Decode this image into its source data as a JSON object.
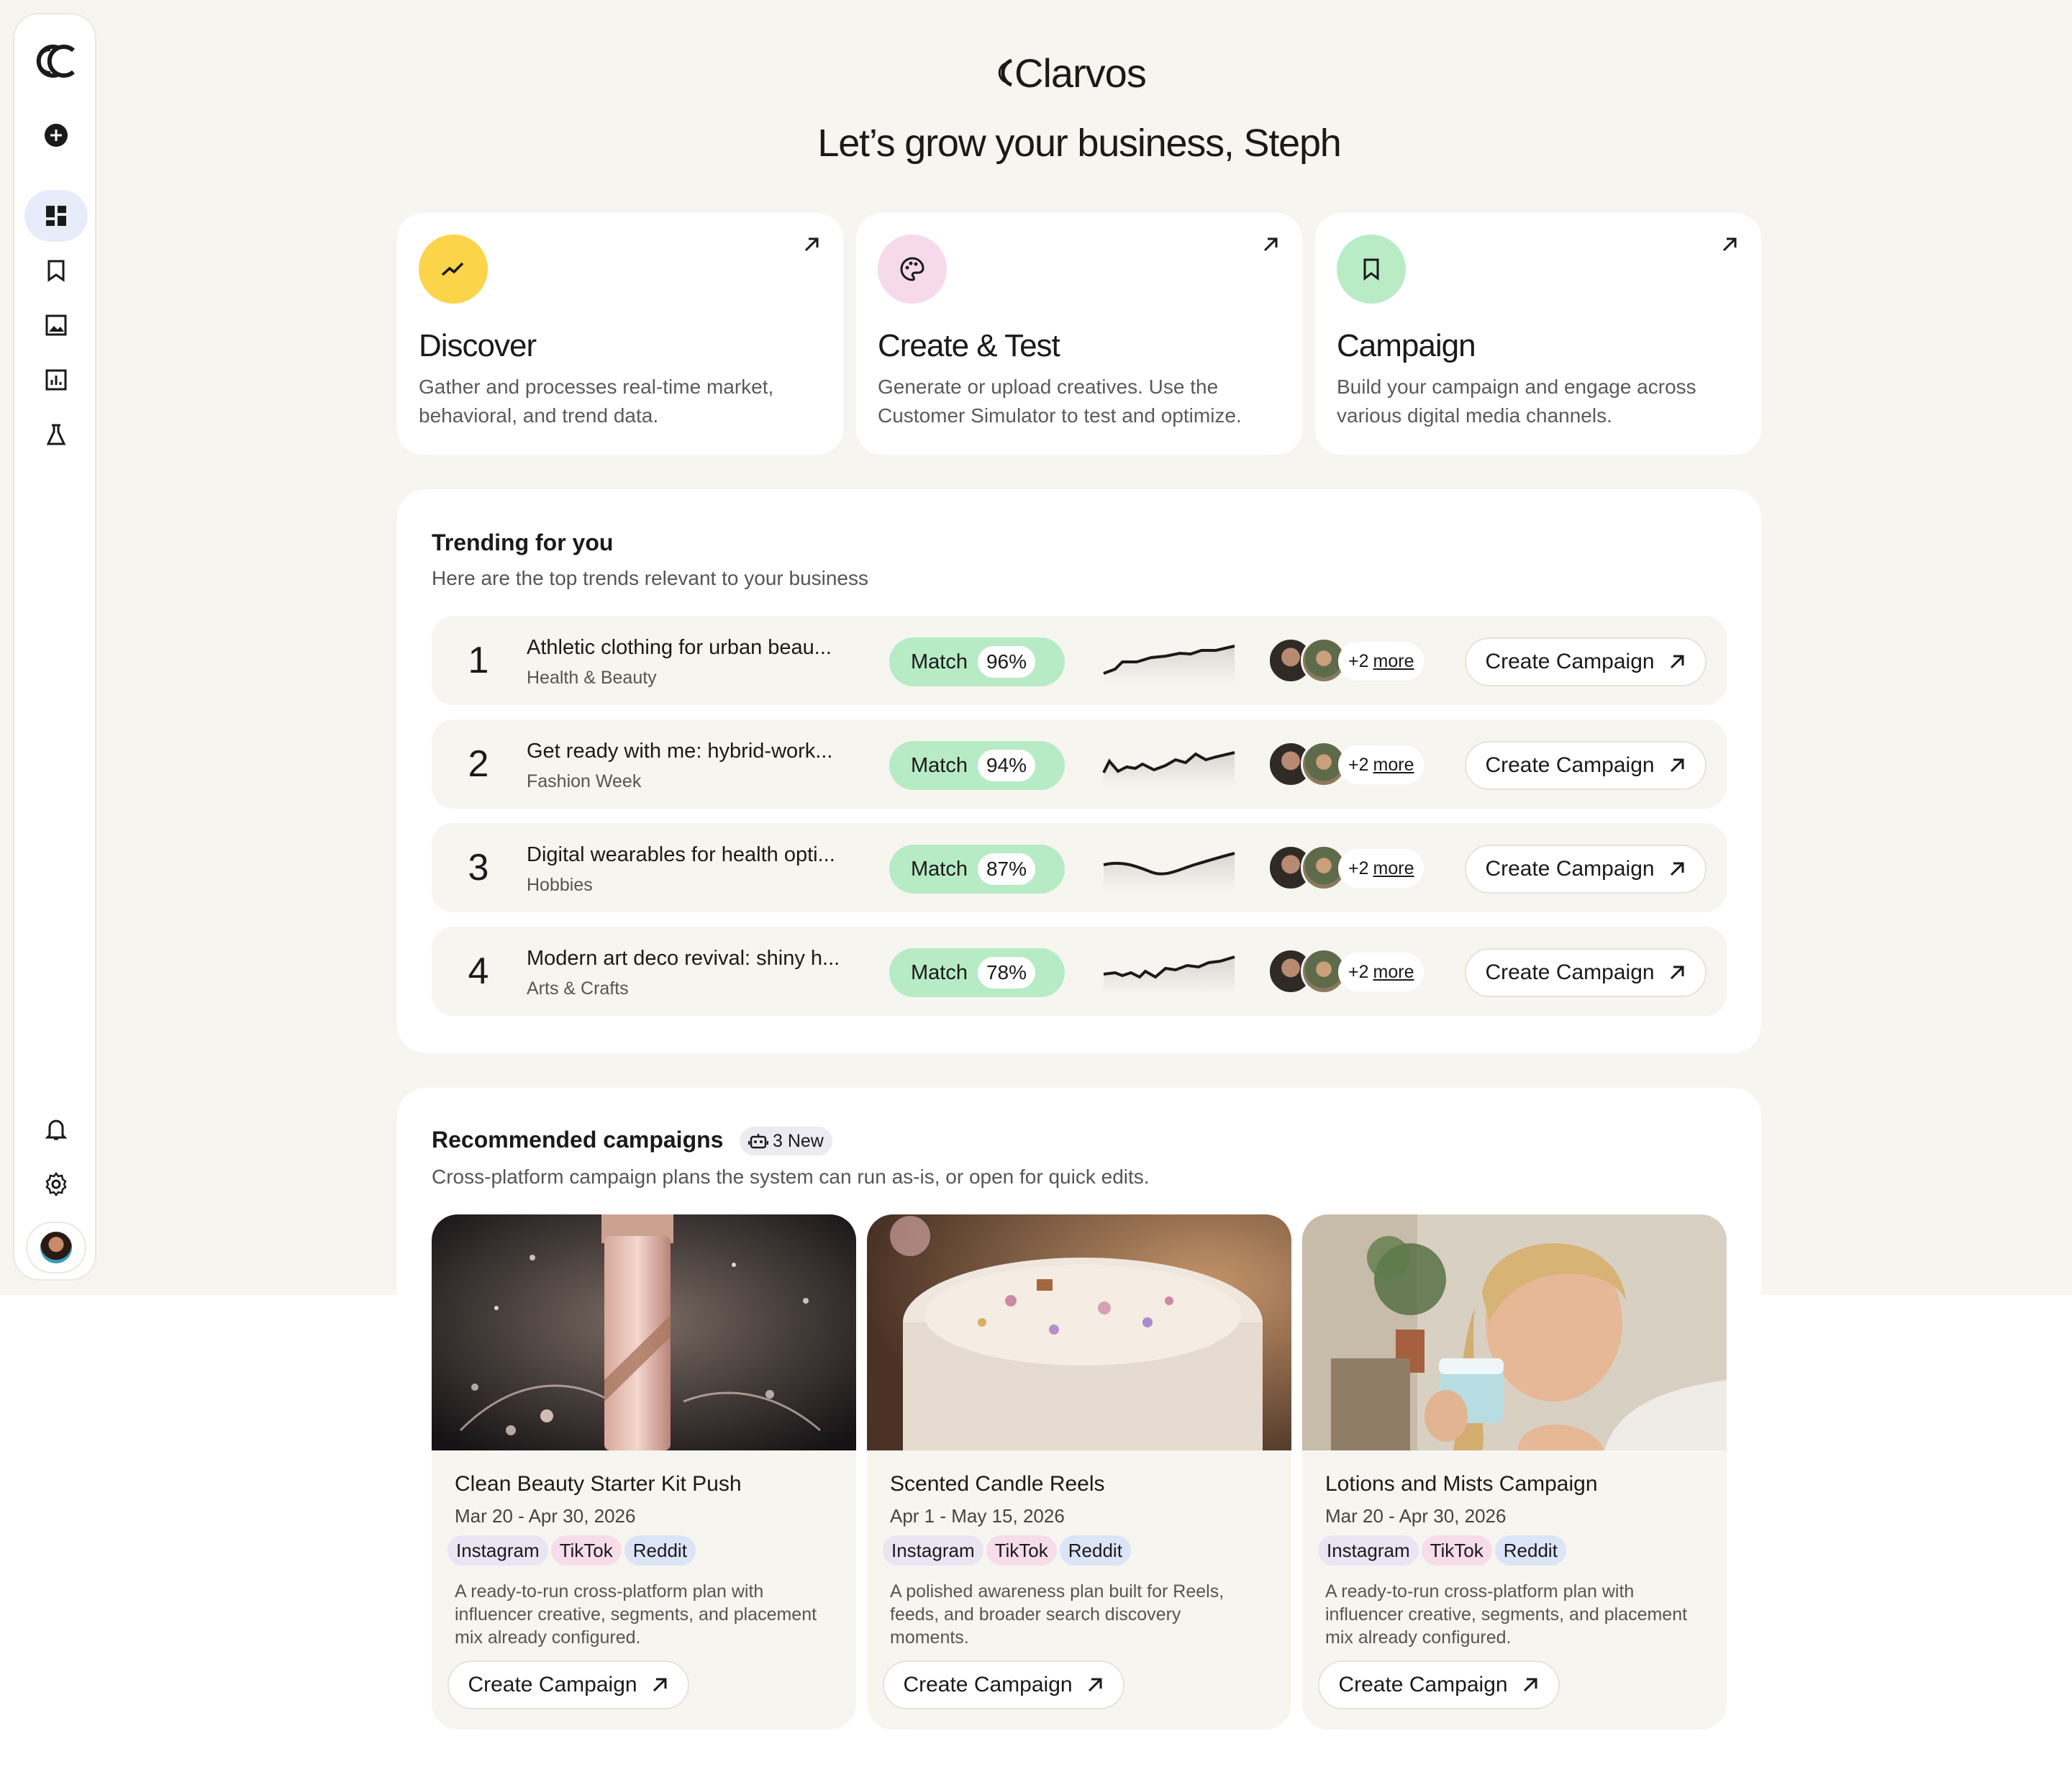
{
  "brand": {
    "name": "Clarvos"
  },
  "greeting": "Let’s grow your business, Steph",
  "cards": [
    {
      "title": "Discover",
      "desc": "Gather and processes real-time market, behavioral, and trend data.",
      "icon": "trend-icon",
      "color": "#fbd44a"
    },
    {
      "title": "Create & Test",
      "desc": "Generate or upload creatives. Use the Customer Simulator to test and optimize.",
      "icon": "palette-icon",
      "color": "#f7d9ec"
    },
    {
      "title": "Campaign",
      "desc": "Build your campaign and engage across various digital media channels.",
      "icon": "bookmark-icon",
      "color": "#b9ecc5"
    }
  ],
  "trending": {
    "title": "Trending for you",
    "subtitle": "Here are the top trends relevant to your business",
    "match_label": "Match",
    "more_prefix": "+2",
    "more_label": "more",
    "cta": "Create Campaign",
    "rows": [
      {
        "rank": "1",
        "title": "Athletic clothing for urban beau...",
        "category": "Health & Beauty",
        "match": "96%"
      },
      {
        "rank": "2",
        "title": "Get ready with me: hybrid-work...",
        "category": "Fashion Week",
        "match": "94%"
      },
      {
        "rank": "3",
        "title": "Digital wearables for health opti...",
        "category": "Hobbies",
        "match": "87%"
      },
      {
        "rank": "4",
        "title": "Modern art deco revival: shiny h...",
        "category": "Arts & Crafts",
        "match": "78%"
      }
    ]
  },
  "recommended": {
    "title": "Recommended campaigns",
    "badge": "3 New",
    "subtitle": "Cross-platform campaign plans the system can run as-is, or open for quick edits.",
    "cta": "Create Campaign",
    "tags": [
      "Instagram",
      "TikTok",
      "Reddit"
    ],
    "items": [
      {
        "title": "Clean Beauty Starter Kit Push",
        "dates": "Mar 20 - Apr 30, 2026",
        "desc": "A ready-to-run cross-platform plan with influencer creative, segments, and placement mix already configured."
      },
      {
        "title": "Scented Candle Reels",
        "dates": "Apr 1 - May 15, 2026",
        "desc": "A polished awareness plan built for Reels, feeds, and broader search discovery moments."
      },
      {
        "title": "Lotions and Mists Campaign",
        "dates": "Mar 20 - Apr 30, 2026",
        "desc": "A ready-to-run cross-platform plan with influencer creative, segments, and placement mix already configured."
      }
    ]
  },
  "sidebar": {
    "items": [
      "new-icon",
      "dashboard-icon",
      "bookmark-icon",
      "image-icon",
      "chart-icon",
      "flask-icon",
      "bell-icon",
      "gear-icon"
    ]
  }
}
